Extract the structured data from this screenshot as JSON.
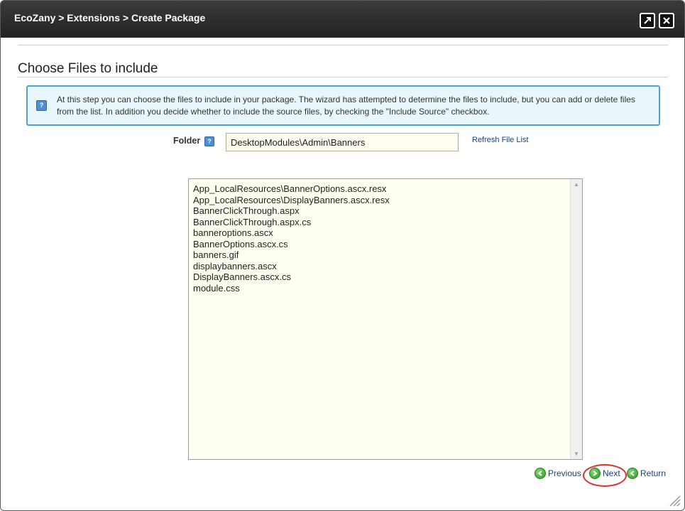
{
  "window": {
    "title": "EcoZany > Extensions > Create Package",
    "maximize_icon": "maximize-icon",
    "close_icon": "close-icon"
  },
  "page": {
    "heading": "Choose Files to include"
  },
  "info": {
    "text": "At this step you can choose the files to include in your package. The wizard has attempted to determine the files to include, but you can add or delete files from the list. In addition you decide whether to include the source files, by checking the \"Include Source\" checkbox.",
    "icon": "info-icon"
  },
  "folder": {
    "label": "Folder",
    "value": "DesktopModules\\Admin\\Banners",
    "refresh_label": "Refresh File List"
  },
  "files": [
    "App_LocalResources\\BannerOptions.ascx.resx",
    "App_LocalResources\\DisplayBanners.ascx.resx",
    "BannerClickThrough.aspx",
    "BannerClickThrough.aspx.cs",
    "banneroptions.ascx",
    "BannerOptions.ascx.cs",
    "banners.gif",
    "displaybanners.ascx",
    "DisplayBanners.ascx.cs",
    "module.css"
  ],
  "nav": {
    "previous_label": "Previous",
    "next_label": "Next",
    "return_label": "Return"
  },
  "colors": {
    "titlebar": "#2b2b2b",
    "info_border": "#4aa3d0",
    "info_bg": "#e9f6fb",
    "link": "#1e3f78",
    "highlight_ring": "#e03030",
    "nav_icon": "#2f9a2a"
  }
}
